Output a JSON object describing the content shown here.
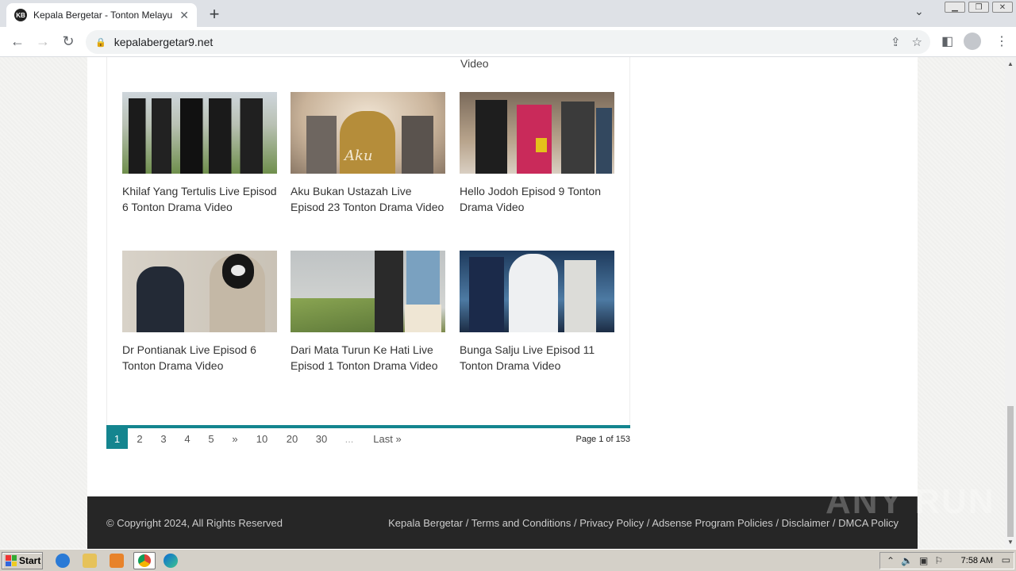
{
  "browser": {
    "tab_title": "Kepala Bergetar - Tonton Melayu Dra",
    "favicon_text": "KB",
    "url": "kepalabergetar9.net"
  },
  "prev_text": "Video",
  "cards": [
    {
      "title": "Khilaf Yang Tertulis Live Episod 6 Tonton Drama Video"
    },
    {
      "title": "Aku Bukan Ustazah Live Episod 23 Tonton Drama Video"
    },
    {
      "title": "Hello Jodoh Episod 9 Tonton Drama Video"
    },
    {
      "title": "Dr Pontianak Live Episod 6 Tonton Drama Video"
    },
    {
      "title": "Dari Mata Turun Ke Hati Live Episod 1 Tonton Drama Video"
    },
    {
      "title": "Bunga Salju Live Episod 11 Tonton Drama Video"
    }
  ],
  "pagination": {
    "pages": [
      "1",
      "2",
      "3",
      "4",
      "5",
      "»",
      "10",
      "20",
      "30",
      "...",
      "Last »"
    ],
    "info": "Page 1 of 153"
  },
  "footer": {
    "copyright": "© Copyright 2024, All Rights Reserved",
    "links": [
      "Kepala Bergetar",
      "Terms and Conditions",
      "Privacy Policy",
      "Adsense Program Policies",
      "Disclaimer",
      "DMCA Policy"
    ],
    "separator": " / "
  },
  "watermark": "ANY RUN",
  "taskbar": {
    "start": "Start",
    "clock": "7:58 AM"
  }
}
